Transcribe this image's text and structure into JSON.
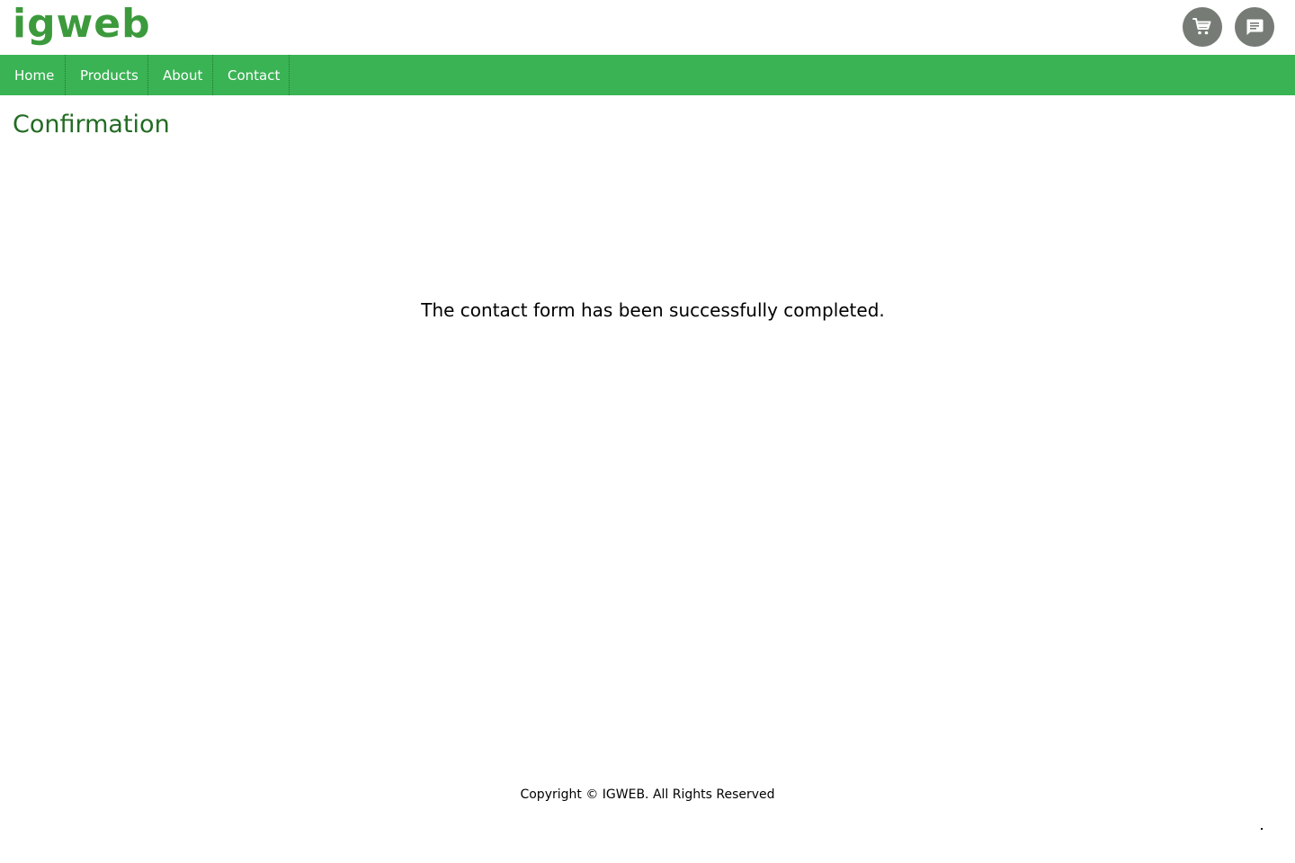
{
  "header": {
    "logo_text": "igweb",
    "cart_icon": "cart-icon",
    "chat_icon": "chat-icon"
  },
  "nav": {
    "items": [
      {
        "label": "Home"
      },
      {
        "label": "Products"
      },
      {
        "label": "About"
      },
      {
        "label": "Contact"
      }
    ]
  },
  "main": {
    "title": "Confirmation",
    "message": "The contact form has been successfully completed."
  },
  "footer": {
    "copyright": "Copyright © IGWEB. All Rights Reserved"
  },
  "colors": {
    "brand_green": "#3ab354",
    "logo_green": "#3c9a3c",
    "title_green": "#236b23",
    "icon_button_gray": "#767b76"
  }
}
